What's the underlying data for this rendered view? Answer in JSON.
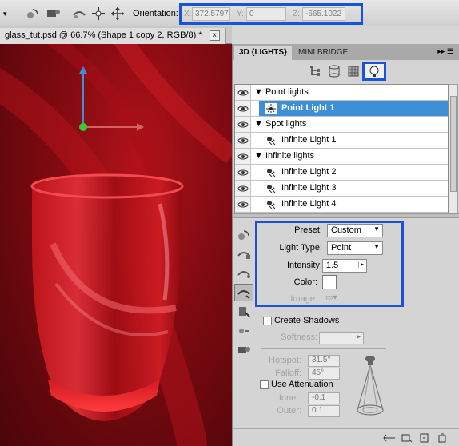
{
  "options_bar": {
    "orientation_label": "Orientation:",
    "x_label": "X:",
    "x_value": "372.5797",
    "y_label": "Y:",
    "y_value": "0",
    "z_label": "Z:",
    "z_value": "-665.1022"
  },
  "document_tab": {
    "title": "glass_tut.psd @ 66.7% (Shape 1 copy 2, RGB/8) *"
  },
  "panel": {
    "tabs": [
      {
        "label": "3D {LIGHTS}"
      },
      {
        "label": "MINI BRIDGE"
      }
    ],
    "lights": [
      {
        "type": "group",
        "label": "Point lights"
      },
      {
        "type": "item",
        "label": "Point Light 1",
        "selected": true,
        "icon": "point-light-icon"
      },
      {
        "type": "group",
        "label": "Spot lights"
      },
      {
        "type": "item",
        "label": "Infinite Light 1",
        "icon": "infinite-light-icon"
      },
      {
        "type": "group",
        "label": "Infinite lights"
      },
      {
        "type": "item",
        "label": "Infinite Light 2",
        "icon": "infinite-light-icon"
      },
      {
        "type": "item",
        "label": "Infinite Light 3",
        "icon": "infinite-light-icon"
      },
      {
        "type": "item",
        "label": "Infinite Light 4",
        "icon": "infinite-light-icon"
      }
    ],
    "properties": {
      "preset_label": "Preset:",
      "preset_value": "Custom",
      "light_type_label": "Light Type:",
      "light_type_value": "Point",
      "intensity_label": "Intensity:",
      "intensity_value": "1.5",
      "color_label": "Color:",
      "color_value": "#ffffff",
      "image_label": "Image:"
    },
    "shadows": {
      "create_shadows_label": "Create Shadows",
      "softness_label": "Softness:"
    },
    "spot": {
      "hotspot_label": "Hotspot:",
      "hotspot_value": "31.5°",
      "falloff_label": "Falloff:",
      "falloff_value": "45°"
    },
    "attenuation": {
      "use_attenuation_label": "Use Attenuation",
      "inner_label": "Inner:",
      "inner_value": "-0.1",
      "outer_label": "Outer:",
      "outer_value": "0.1"
    }
  },
  "colors": {
    "highlight_box": "#1a53d6",
    "selection": "#3d8fd8",
    "canvas_red": "#8a0b12"
  }
}
